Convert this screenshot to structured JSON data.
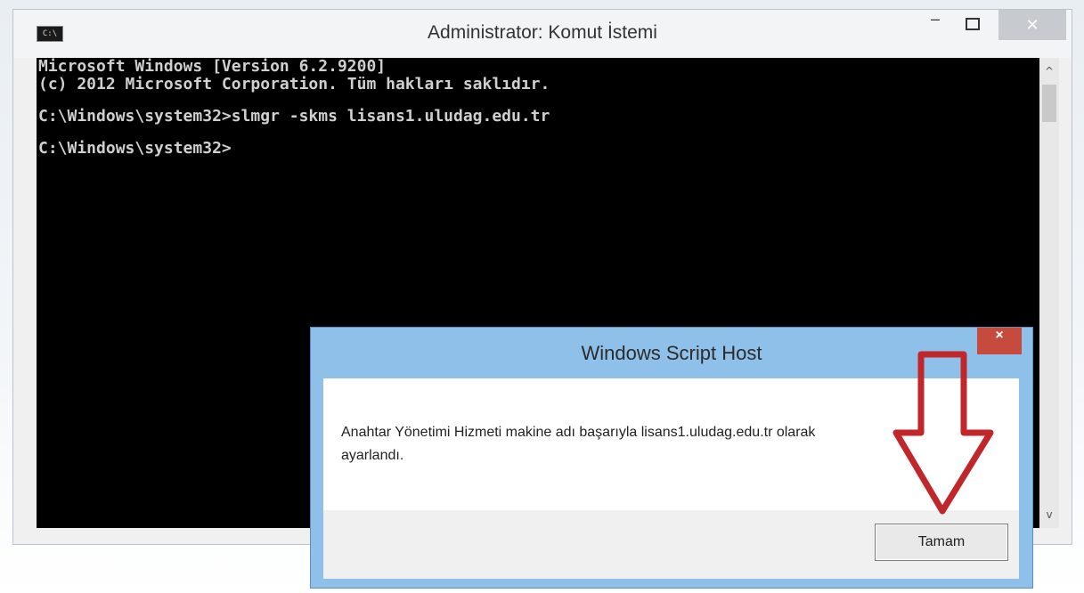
{
  "console": {
    "title": "Administrator: Komut İstemi",
    "icon_label": "C:\\",
    "window_controls": {
      "minimize": "–",
      "close": "✕"
    },
    "lines": [
      "Microsoft Windows [Version 6.2.9200]",
      "(c) 2012 Microsoft Corporation. Tüm hakları saklıdır.",
      "",
      "C:\\Windows\\system32>slmgr -skms lisans1.uludag.edu.tr",
      "",
      "C:\\Windows\\system32>"
    ],
    "scroll": {
      "up": "^",
      "down": "v"
    }
  },
  "dialog": {
    "title": "Windows Script Host",
    "close_label": "×",
    "message_line1": "Anahtar Yönetimi Hizmeti makine adı başarıyla lisans1.uludag.edu.tr olarak",
    "message_line2": "ayarlandı.",
    "ok_button": "Tamam"
  },
  "colors": {
    "console_bg": "#000000",
    "console_text": "#cfcfcf",
    "dialog_frame": "#8fc0ea",
    "dialog_close": "#c74a3f",
    "arrow": "#c0262a"
  },
  "icons": {
    "app_icon": "cmd-icon",
    "arrow": "down-arrow-annotation"
  }
}
